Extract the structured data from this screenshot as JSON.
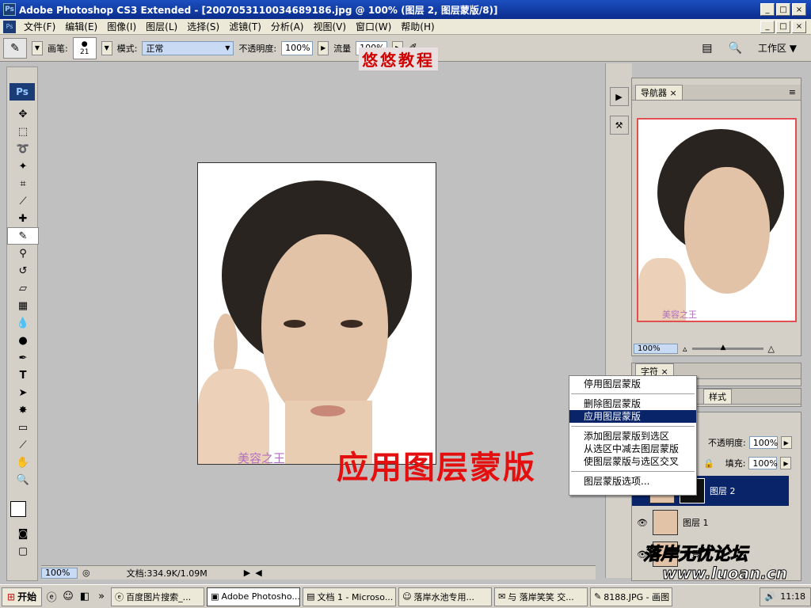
{
  "window": {
    "title": "Adobe Photoshop CS3 Extended - [2007053110034689186.jpg @ 100% (图层 2, 图层蒙版/8)]",
    "app_icon": "Ps",
    "buttons": [
      "_",
      "□",
      "×"
    ],
    "doc_buttons": [
      "_",
      "□",
      "×"
    ]
  },
  "menu": [
    "文件(F)",
    "编辑(E)",
    "图像(I)",
    "图层(L)",
    "选择(S)",
    "滤镜(T)",
    "分析(A)",
    "视图(V)",
    "窗口(W)",
    "帮助(H)"
  ],
  "options": {
    "brush_label": "画笔:",
    "brush_size": "21",
    "mode_label": "模式:",
    "mode_value": "正常",
    "opacity_label": "不透明度:",
    "opacity_value": "100%",
    "flow_label": "流量",
    "flow_value": "100%",
    "workspace_label": "工作区"
  },
  "toolbox": {
    "logo": "Ps",
    "tools": [
      "move-icon",
      "marquee-icon",
      "lasso-icon",
      "magic-wand-icon",
      "crop-icon",
      "slice-icon",
      "healing-icon",
      "brush-icon",
      "clone-stamp-icon",
      "history-brush-icon",
      "eraser-icon",
      "gradient-icon",
      "blur-icon",
      "dodge-icon",
      "pen-icon",
      "type-icon",
      "path-select-icon",
      "shape-icon",
      "notes-icon",
      "eyedropper-icon",
      "hand-icon",
      "zoom-icon"
    ],
    "type_glyph": "T"
  },
  "overlay": {
    "youyou": "悠悠教程",
    "apply_mask": "应用图层蒙版",
    "doc_watermark": "美容之王",
    "nav_watermark": "美容之王"
  },
  "status": {
    "zoom": "100%",
    "doc_info": "文档:334.9K/1.09M"
  },
  "navigator": {
    "tab": "导航器",
    "zoom": "100%"
  },
  "char_panel": {
    "tab": "字符"
  },
  "style_panel": {
    "tab": "样式"
  },
  "layers": {
    "opacity_label": "不透明度:",
    "opacity_value": "100%",
    "fill_label": "填充:",
    "fill_value": "100%",
    "items": [
      {
        "name": "图层 2",
        "selected": true
      },
      {
        "name": "图层 1",
        "selected": false
      },
      {
        "name": "背景",
        "selected": false
      }
    ]
  },
  "context_menu": {
    "items": [
      {
        "label": "停用图层蒙版",
        "selected": false
      },
      {
        "label": "删除图层蒙版",
        "selected": false
      },
      {
        "label": "应用图层蒙版",
        "selected": true
      },
      {
        "label": "添加图层蒙版到选区",
        "selected": false
      },
      {
        "label": "从选区中减去图层蒙版",
        "selected": false
      },
      {
        "label": "使图层蒙版与选区交叉",
        "selected": false
      },
      {
        "label": "图层蒙版选项...",
        "selected": false
      }
    ]
  },
  "taskbar": {
    "start": "开始",
    "items": [
      "百度图片搜索_...",
      "Adobe Photosho...",
      "文档 1 - Microso...",
      "落岸水池专用...",
      "与 落岸笑笑 交...",
      "8188.JPG - 画图"
    ],
    "clock": "11:18"
  },
  "branding": {
    "logo": "落岸无忧论坛",
    "url": "www.luoan.cn"
  }
}
